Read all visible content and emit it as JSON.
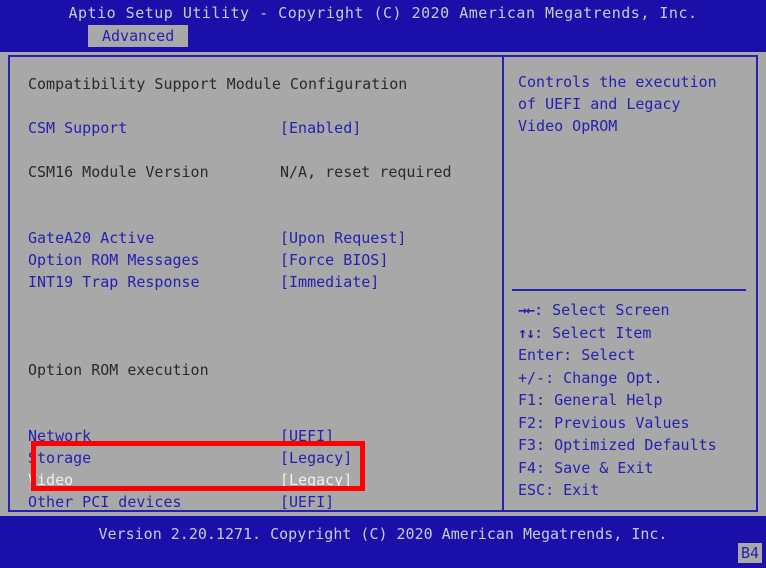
{
  "header": {
    "title": "Aptio Setup Utility - Copyright (C) 2020 American Megatrends, Inc.",
    "active_tab": "Advanced"
  },
  "colors": {
    "background_blue": "#1a0fa8",
    "panel_gray": "#a8a8a8",
    "text_blue": "#2520b0",
    "text_dark": "#2a2a2a",
    "selected_text": "#f0f0f0",
    "annotation_red": "#fe0000",
    "header_text": "#c9cbd4"
  },
  "main": {
    "section_title": "Compatibility Support Module Configuration",
    "group_title": "Option ROM execution",
    "settings": [
      {
        "label": "CSM Support",
        "value": "[Enabled]",
        "style": "link"
      },
      {
        "label": "CSM16 Module Version",
        "value": "N/A, reset required",
        "style": "plain"
      },
      {
        "label": "GateA20 Active",
        "value": "[Upon Request]",
        "style": "link"
      },
      {
        "label": "Option ROM Messages",
        "value": "[Force BIOS]",
        "style": "link"
      },
      {
        "label": "INT19 Trap Response",
        "value": "[Immediate]",
        "style": "link"
      }
    ],
    "oprom_items": [
      {
        "label": "Network",
        "value": "[UEFI]",
        "style": "link"
      },
      {
        "label": "Storage",
        "value": "[Legacy]",
        "style": "link"
      },
      {
        "label": "Video",
        "value": "[Legacy]",
        "style": "selected"
      },
      {
        "label": "Other PCI devices",
        "value": "[UEFI]",
        "style": "link"
      }
    ]
  },
  "help": {
    "description_lines": [
      "Controls the execution",
      "of UEFI and Legacy",
      "Video OpROM"
    ],
    "nav_keys": [
      {
        "glyph": "→←",
        "text": ": Select Screen"
      },
      {
        "glyph": "↑↓",
        "text": ": Select Item"
      },
      {
        "glyph": "",
        "text": "Enter: Select"
      },
      {
        "glyph": "",
        "text": "+/-: Change Opt."
      },
      {
        "glyph": "",
        "text": "F1: General Help"
      },
      {
        "glyph": "",
        "text": "F2: Previous Values"
      },
      {
        "glyph": "",
        "text": "F3: Optimized Defaults"
      },
      {
        "glyph": "",
        "text": "F4: Save & Exit"
      },
      {
        "glyph": "",
        "text": "ESC: Exit"
      }
    ]
  },
  "footer": {
    "version_text": "Version 2.20.1271. Copyright (C) 2020 American Megatrends, Inc.",
    "build_badge": "B4"
  }
}
